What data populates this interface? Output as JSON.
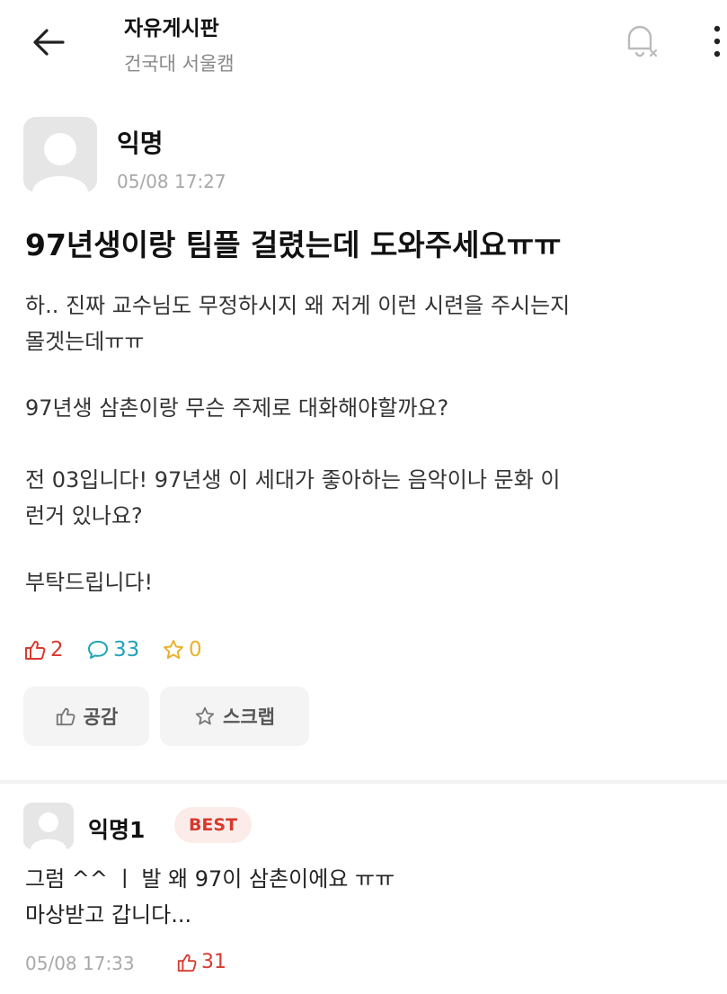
{
  "header": {
    "board_title": "자유게시판",
    "board_subtitle": "건국대 서울캠",
    "icons": [
      "back-arrow-icon",
      "bell-off-icon",
      "more-vertical-icon"
    ]
  },
  "post": {
    "author": "익명",
    "time": "05/08 17:27",
    "title": "97년생이랑 팀플 걸렸는데 도와주세요ㅠㅠ",
    "body_lines": [
      "하.. 진짜 교수님도 무정하시지 왜 저게 이런 시련을 주시는지",
      "몰겟는데ㅠㅠ",
      "97년생 삼촌이랑 무슨 주제로 대화해야할까요?",
      "전 03입니다! 97년생 이 세대가 좋아하는 음악이나 문화 이",
      "런거 있나요?",
      "부탁드립니다!"
    ],
    "stats": {
      "likes": "2",
      "comments": "33",
      "scraps": "0"
    },
    "actions": {
      "like_label": "공감",
      "scrap_label": "스크랩"
    },
    "colors": {
      "likes": "#d63a2f",
      "comments": "#1fa3b8",
      "scraps": "#e8b32a"
    }
  },
  "comment": {
    "author": "익명1",
    "badge": "BEST",
    "lines": [
      "그럼 ^^ ㅣ 발 왜 97이 삼촌이에요 ㅠㅠ",
      "마상받고 갑니다..."
    ],
    "time": "05/08 17:33",
    "likes": "31"
  }
}
